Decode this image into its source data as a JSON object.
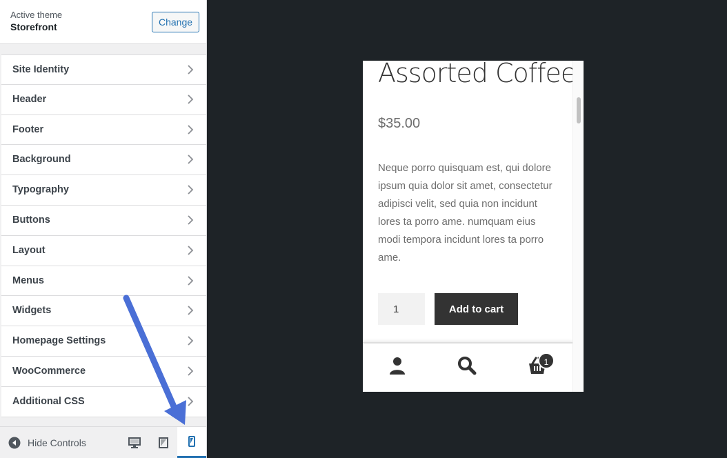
{
  "sidebar": {
    "theme_label": "Active theme",
    "theme_name": "Storefront",
    "change_label": "Change",
    "items": [
      {
        "label": "Site Identity"
      },
      {
        "label": "Header"
      },
      {
        "label": "Footer"
      },
      {
        "label": "Background"
      },
      {
        "label": "Typography"
      },
      {
        "label": "Buttons"
      },
      {
        "label": "Layout"
      },
      {
        "label": "Menus"
      },
      {
        "label": "Widgets"
      },
      {
        "label": "Homepage Settings"
      },
      {
        "label": "WooCommerce"
      },
      {
        "label": "Additional CSS"
      }
    ],
    "hide_controls_label": "Hide Controls",
    "devices": [
      "desktop-icon",
      "tablet-icon",
      "mobile-icon"
    ],
    "active_device": "mobile"
  },
  "preview": {
    "product_title": "Assorted Coffee",
    "price": "$35.00",
    "description": "Neque porro quisquam est, qui dolore ipsum quia dolor sit amet, consectetur adipisci velit, sed quia non incidunt lores ta porro ame. numquam eius modi tempora incidunt lores ta porro ame.",
    "quantity": "1",
    "add_to_cart_label": "Add to cart",
    "cart_count": "1"
  },
  "colors": {
    "accent": "#2271b1",
    "arrow": "#4a6fd6",
    "dark_bg": "#1e2327"
  }
}
